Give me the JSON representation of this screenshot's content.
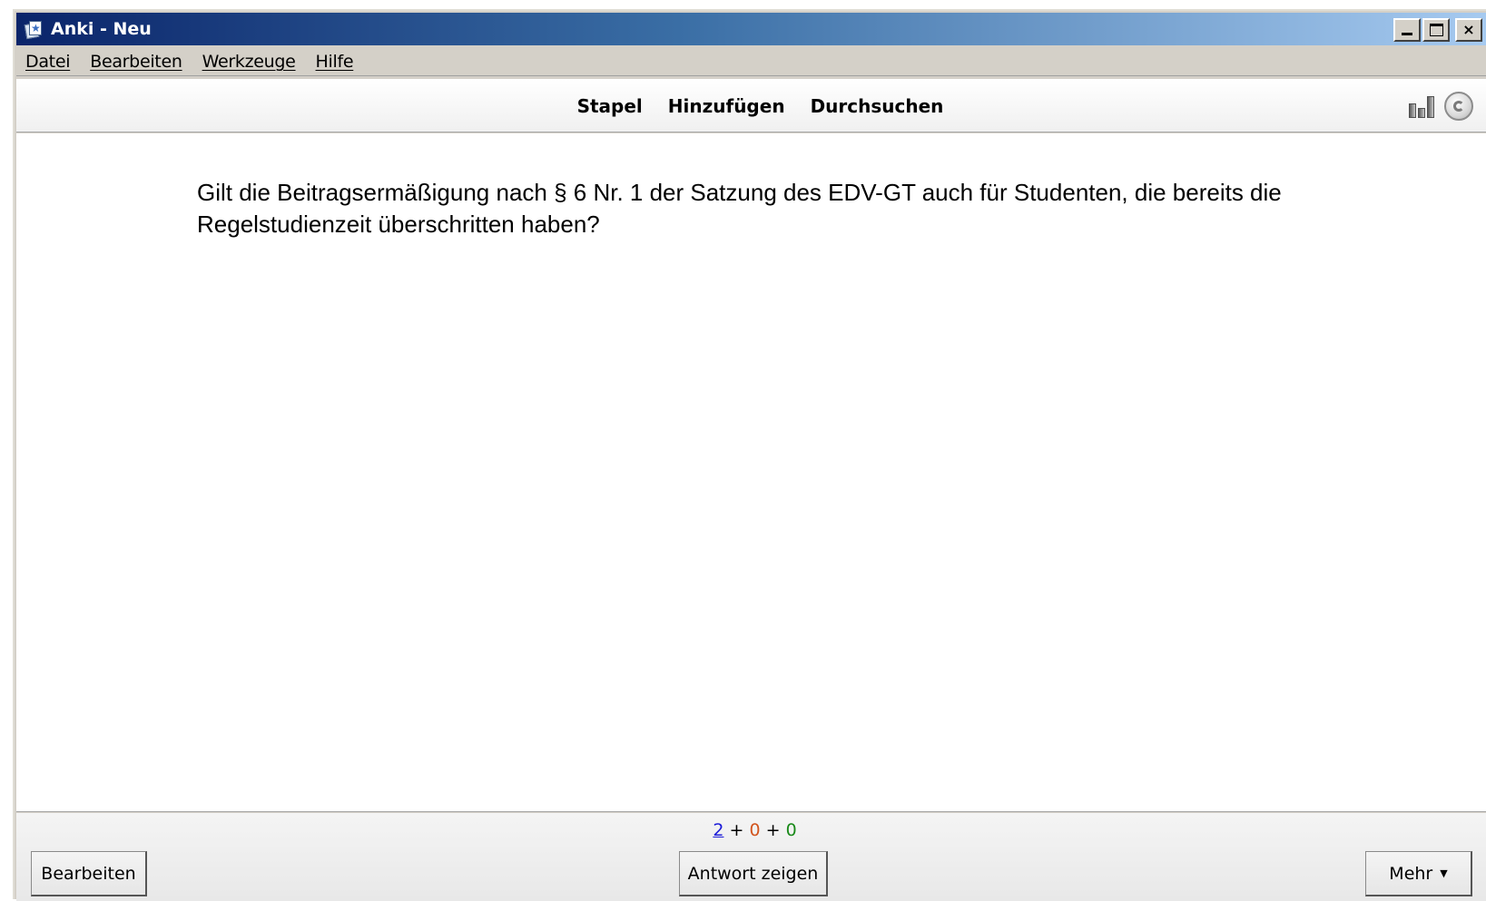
{
  "window": {
    "title": "Anki - Neu",
    "icon": "anki-app-icon",
    "controls": [
      "minimize-icon",
      "maximize-icon",
      "close-icon"
    ],
    "close_label": "×"
  },
  "menu": {
    "items": [
      {
        "label": "Datei"
      },
      {
        "label": "Bearbeiten"
      },
      {
        "label": "Werkzeuge"
      },
      {
        "label": "Hilfe"
      }
    ]
  },
  "toolbar": {
    "links": [
      {
        "label": "Stapel"
      },
      {
        "label": "Hinzufügen"
      },
      {
        "label": "Durchsuchen"
      }
    ],
    "icons": [
      "stats-icon",
      "sync-icon"
    ]
  },
  "card": {
    "question": "Gilt die Beitragsermäßigung nach § 6 Nr. 1 der Satzung des EDV-GT auch für Studenten, die bereits die Regelstudienzeit überschritten haben?"
  },
  "bottom": {
    "counts": {
      "new": "2",
      "learning": "0",
      "review": "0",
      "plus": "+"
    },
    "colors": {
      "new": "#1a1ad8",
      "learning": "#d2551e",
      "review": "#1a8a1a"
    },
    "edit_label": "Bearbeiten",
    "answer_label": "Antwort zeigen",
    "more_label": "Mehr",
    "more_arrow": "▼"
  }
}
